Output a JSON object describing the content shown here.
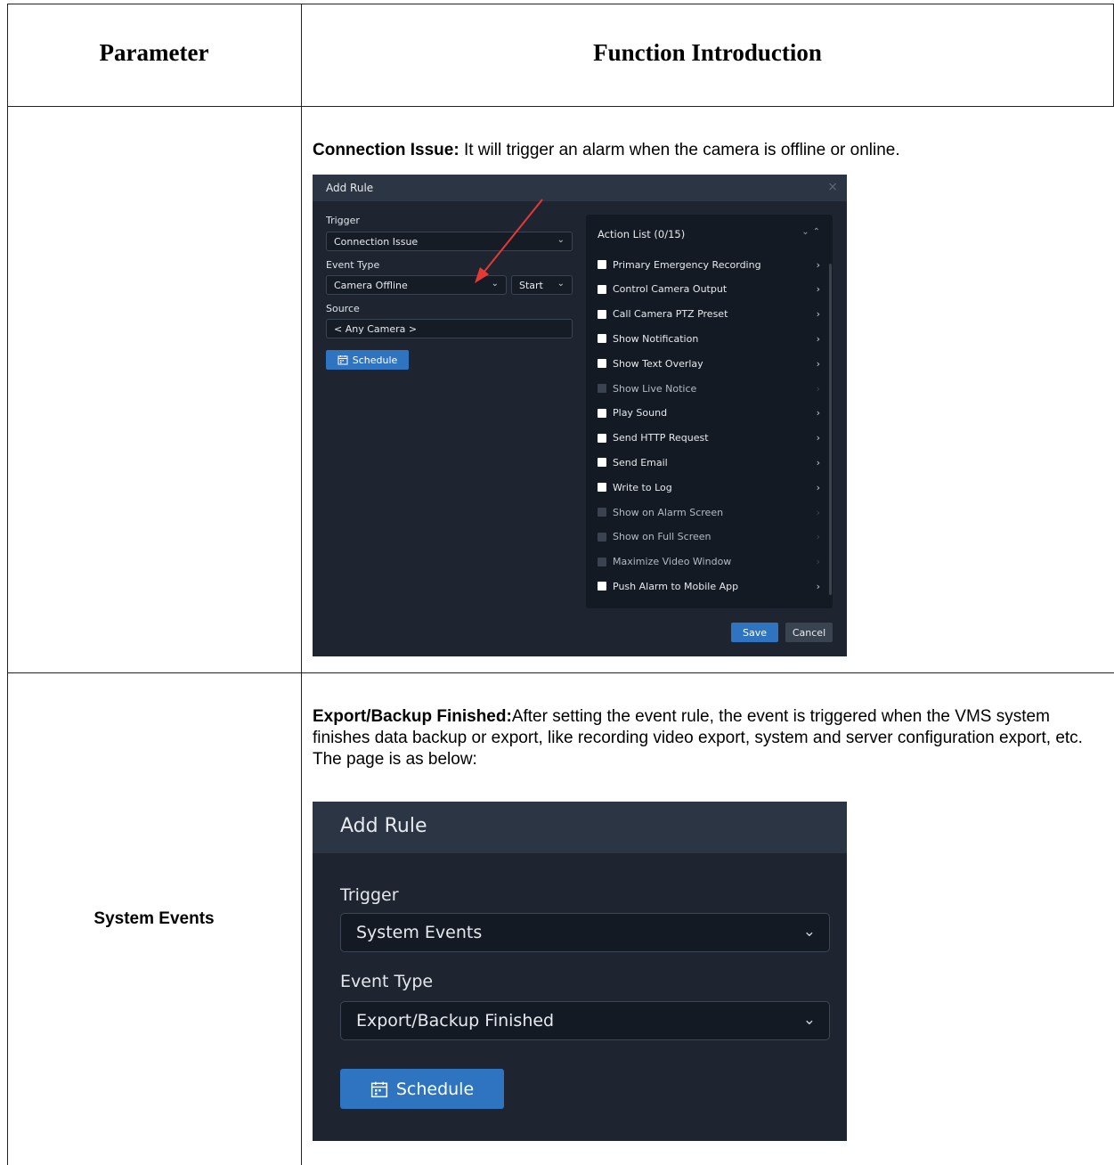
{
  "table": {
    "headers": [
      "Parameter",
      "Function Introduction"
    ],
    "rows": [
      {
        "parameter": "",
        "intro_bold": "Connection Issue:",
        "intro_text": " It will trigger an alarm when the camera is offline or online."
      },
      {
        "parameter": "System Events",
        "intro_bold": "Export/Backup Finished:",
        "intro_text": "After setting the event rule, the event is triggered when the VMS system finishes data backup or export, like recording video export, system and server configuration export, etc. The page is as below:"
      }
    ]
  },
  "dialog1": {
    "title": "Add Rule",
    "close_icon": "×",
    "trigger_label": "Trigger",
    "trigger_value": "Connection Issue",
    "event_type_label": "Event Type",
    "event_type_value": "Camera Offline",
    "event_state_value": "Start",
    "source_label": "Source",
    "source_value": "< Any Camera >",
    "schedule_label": "Schedule",
    "action_list_title": "Action List (0/15)",
    "actions": [
      {
        "label": "Primary Emergency Recording",
        "enabled": true
      },
      {
        "label": "Control Camera Output",
        "enabled": true
      },
      {
        "label": "Call Camera PTZ Preset",
        "enabled": true
      },
      {
        "label": "Show Notification",
        "enabled": true
      },
      {
        "label": "Show Text Overlay",
        "enabled": true
      },
      {
        "label": "Show Live Notice",
        "enabled": false
      },
      {
        "label": "Play Sound",
        "enabled": true
      },
      {
        "label": "Send HTTP Request",
        "enabled": true
      },
      {
        "label": "Send Email",
        "enabled": true
      },
      {
        "label": "Write to Log",
        "enabled": true
      },
      {
        "label": "Show on Alarm Screen",
        "enabled": false
      },
      {
        "label": "Show on Full Screen",
        "enabled": false
      },
      {
        "label": "Maximize Video Window",
        "enabled": false
      },
      {
        "label": "Push Alarm to Mobile App",
        "enabled": true
      }
    ],
    "save_label": "Save",
    "cancel_label": "Cancel"
  },
  "dialog2": {
    "title": "Add Rule",
    "trigger_label": "Trigger",
    "trigger_value": "System Events",
    "event_type_label": "Event Type",
    "event_type_value": "Export/Backup Finished",
    "schedule_label": "Schedule"
  },
  "colors": {
    "dialog_bg": "#1e2531",
    "titlebar_bg": "#2c3543",
    "primary_button": "#2e74c0",
    "annotation_arrow": "#e53935"
  }
}
